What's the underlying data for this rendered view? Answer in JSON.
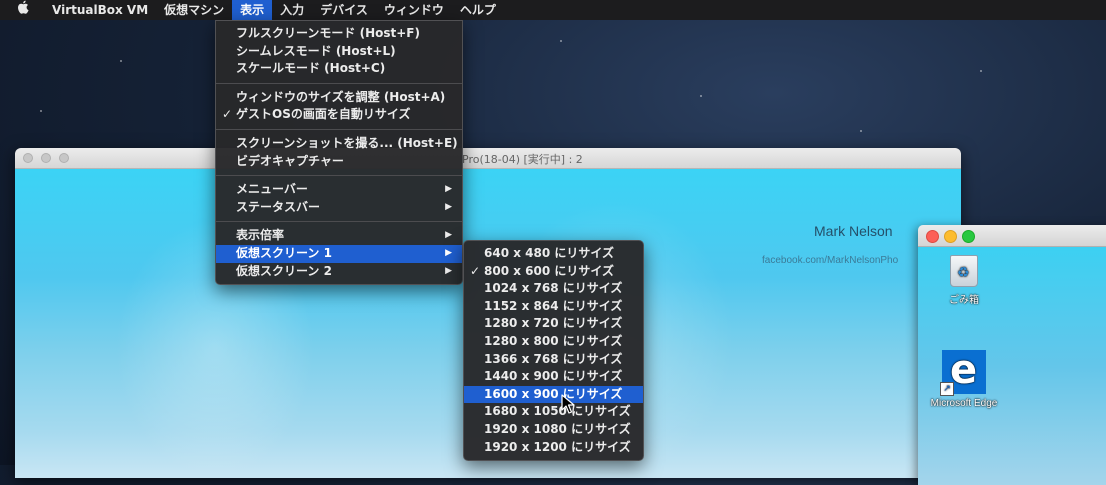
{
  "menubar": {
    "apple_icon": "apple-icon",
    "app_name": "VirtualBox VM",
    "items": [
      "仮想マシン",
      "表示",
      "入力",
      "デバイス",
      "ウィンドウ",
      "ヘルプ"
    ],
    "active_index": 1
  },
  "vm_window": {
    "title": "Pro(18-04) [実行中] : 2",
    "wallpaper_credit_name": "Mark Nelson",
    "wallpaper_credit_url": "facebook.com/MarkNelsonPho"
  },
  "guest_window_2": {
    "icons": [
      {
        "icon": "recycle-bin-icon",
        "label": "ごみ箱"
      },
      {
        "icon": "edge-icon",
        "label": "Microsoft Edge"
      }
    ]
  },
  "view_menu": {
    "group1": [
      {
        "label": "フルスクリーンモード (Host+F)"
      },
      {
        "label": "シームレスモード (Host+L)"
      },
      {
        "label": "スケールモード (Host+C)"
      }
    ],
    "group2": [
      {
        "label": "ウィンドウのサイズを調整 (Host+A)",
        "checked": false
      },
      {
        "label": "ゲストOSの画面を自動リサイズ",
        "checked": true
      }
    ],
    "group3": [
      {
        "label": "スクリーンショットを撮る... (Host+E)"
      },
      {
        "label": "ビデオキャプチャー"
      }
    ],
    "group4": [
      {
        "label": "メニューバー",
        "submenu": true
      },
      {
        "label": "ステータスバー",
        "submenu": true
      }
    ],
    "group5": [
      {
        "label": "表示倍率",
        "submenu": true
      },
      {
        "label": "仮想スクリーン 1",
        "submenu": true,
        "highlighted": true
      },
      {
        "label": "仮想スクリーン 2",
        "submenu": true
      }
    ]
  },
  "screen_submenu": {
    "items": [
      {
        "label": "640 x 480 にリサイズ"
      },
      {
        "label": "800 x 600 にリサイズ",
        "checked": true
      },
      {
        "label": "1024 x 768 にリサイズ"
      },
      {
        "label": "1152 x 864 にリサイズ"
      },
      {
        "label": "1280 x 720 にリサイズ"
      },
      {
        "label": "1280 x 800 にリサイズ"
      },
      {
        "label": "1366 x 768 にリサイズ"
      },
      {
        "label": "1440 x 900 にリサイズ"
      },
      {
        "label": "1600 x 900 にリサイズ",
        "highlighted": true
      },
      {
        "label": "1680 x 1050 にリサイズ"
      },
      {
        "label": "1920 x 1080 にリサイズ"
      },
      {
        "label": "1920 x 1200 にリサイズ"
      }
    ]
  },
  "glyphs": {
    "check": "✓",
    "submenu_arrow": "▶"
  },
  "colors": {
    "menu_highlight": "#1f5fd0",
    "menubar_bg": "#1c1c1e",
    "menu_bg": "#28282a"
  }
}
